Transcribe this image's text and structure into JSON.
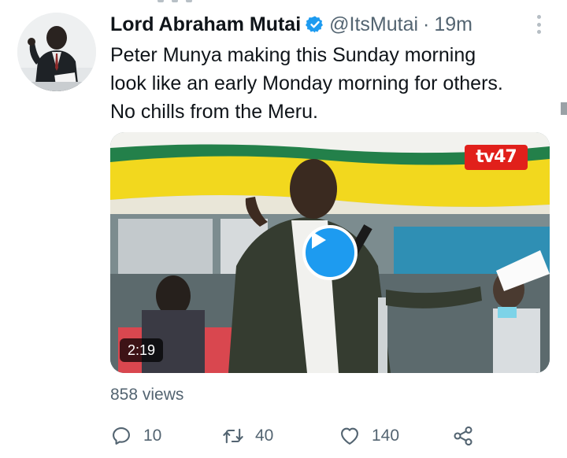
{
  "tweet": {
    "author": {
      "display_name": "Lord Abraham Mutai",
      "handle": "@ItsMutai",
      "verified": true,
      "avatar_icon": "user-photo"
    },
    "separator": "·",
    "time": "19m",
    "text_lines": [
      "Peter Munya making this Sunday morning",
      "look like an early Monday morning for others.",
      "No chills from the Meru."
    ],
    "media": {
      "type": "video",
      "duration": "2:19",
      "channel_logo": "tv47",
      "play_icon": "play-icon"
    },
    "views": "858 views",
    "actions": {
      "reply": {
        "icon": "reply-icon",
        "count": "10"
      },
      "retweet": {
        "icon": "retweet-icon",
        "count": "40"
      },
      "like": {
        "icon": "heart-icon",
        "count": "140"
      },
      "share": {
        "icon": "share-icon"
      }
    }
  },
  "colors": {
    "accent": "#1d9bf0",
    "text_primary": "#0f1419",
    "text_secondary": "#536471",
    "logo_red": "#e1201b"
  }
}
